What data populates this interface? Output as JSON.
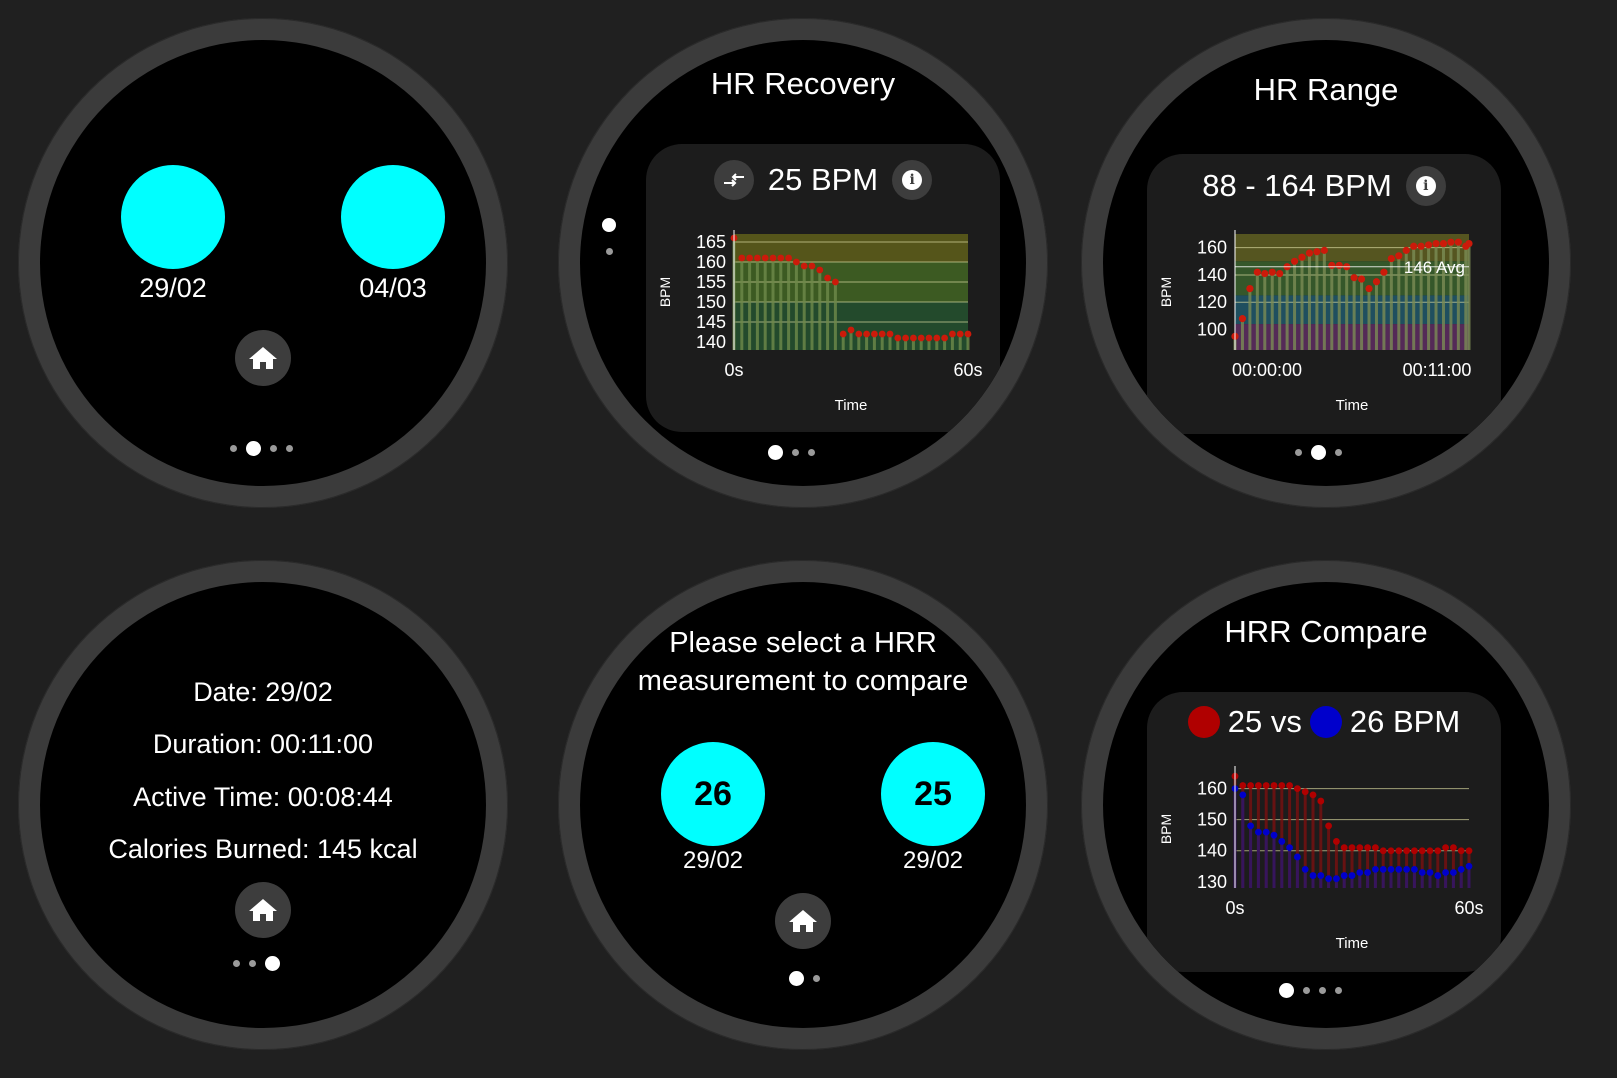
{
  "screen1": {
    "dates": [
      "29/02",
      "04/03"
    ],
    "home_label": "home"
  },
  "screen2": {
    "title": "HR Recovery",
    "value": "25 BPM",
    "ylabel": "BPM",
    "xlabel": "Time",
    "xticks": [
      "0s",
      "60s"
    ],
    "yticks": [
      "165",
      "160",
      "155",
      "150",
      "145",
      "140"
    ]
  },
  "screen3": {
    "title": "HR Range",
    "value": "88 - 164 BPM",
    "ylabel": "BPM",
    "xlabel": "Time",
    "xticks": [
      "00:00:00",
      "00:11:00"
    ],
    "yticks": [
      "160",
      "140",
      "120",
      "100"
    ],
    "avg_label": "146 Avg"
  },
  "screen4": {
    "date": "Date: 29/02",
    "duration": "Duration: 00:11:00",
    "active_time": "Active Time: 00:08:44",
    "calories": "Calories Burned: 145 kcal"
  },
  "screen5": {
    "prompt_line1": "Please select a HRR",
    "prompt_line2": "measurement to compare",
    "items": [
      {
        "value": "26",
        "date": "29/02"
      },
      {
        "value": "25",
        "date": "29/02"
      }
    ]
  },
  "screen6": {
    "title": "HRR Compare",
    "value_a": "25 vs",
    "value_b": "26 BPM",
    "ylabel": "BPM",
    "xlabel": "Time",
    "xticks": [
      "0s",
      "60s"
    ],
    "yticks": [
      "160",
      "150",
      "140",
      "130"
    ]
  },
  "colors": {
    "accent": "#00ffff",
    "recovery_point": "#cc1a0a",
    "compare_a": "#b00000",
    "compare_b": "#0000cc"
  },
  "chart_data": [
    {
      "type": "bar",
      "title": "",
      "xlabel": "Time",
      "ylabel": "BPM",
      "ylim": [
        138,
        167
      ],
      "xlim": [
        0,
        60
      ],
      "x": [
        0,
        2,
        4,
        6,
        8,
        10,
        12,
        14,
        16,
        18,
        20,
        22,
        24,
        26,
        28,
        30,
        32,
        34,
        36,
        38,
        40,
        42,
        44,
        46,
        48,
        50,
        52,
        54,
        56,
        58,
        60
      ],
      "series": [
        {
          "values": [
            166,
            161,
            161,
            161,
            161,
            161,
            161,
            161,
            160,
            159,
            159,
            158,
            156,
            155,
            142,
            143,
            142,
            142,
            142,
            142,
            142,
            141,
            141,
            141,
            141,
            141,
            141,
            141,
            142,
            142,
            142
          ]
        }
      ]
    },
    {
      "type": "bar",
      "title": "",
      "xlabel": "Time",
      "ylabel": "BPM",
      "ylim": [
        85,
        170
      ],
      "x": [
        0,
        0.35,
        0.7,
        1.05,
        1.4,
        1.75,
        2.1,
        2.45,
        2.8,
        3.15,
        3.5,
        3.85,
        4.2,
        4.55,
        4.9,
        5.25,
        5.6,
        5.95,
        6.3,
        6.65,
        7,
        7.35,
        7.7,
        8.05,
        8.4,
        8.75,
        9.1,
        9.45,
        9.8,
        10.15,
        10.5,
        10.85,
        11
      ],
      "series": [
        {
          "values": [
            95,
            108,
            130,
            142,
            141,
            142,
            141,
            146,
            150,
            153,
            156,
            157,
            158,
            147,
            147,
            146,
            138,
            137,
            130,
            135,
            142,
            152,
            154,
            158,
            161,
            161,
            162,
            163,
            163,
            164,
            164,
            161,
            163
          ]
        }
      ],
      "annotations": [
        "146 Avg"
      ]
    },
    {
      "type": "bar",
      "title": "",
      "xlabel": "Time",
      "ylabel": "BPM",
      "ylim": [
        128,
        166
      ],
      "x": [
        0,
        2,
        4,
        6,
        8,
        10,
        12,
        14,
        16,
        18,
        20,
        22,
        24,
        26,
        28,
        30,
        32,
        34,
        36,
        38,
        40,
        42,
        44,
        46,
        48,
        50,
        52,
        54,
        56,
        58,
        60
      ],
      "series": [
        {
          "values": [
            164,
            161,
            161,
            161,
            161,
            161,
            161,
            161,
            160,
            159,
            158,
            156,
            148,
            143,
            141,
            141,
            141,
            141,
            141,
            140,
            140,
            140,
            140,
            140,
            140,
            140,
            140,
            141,
            141,
            140,
            140
          ]
        },
        {
          "values": [
            160,
            158,
            148,
            146,
            146,
            145,
            143,
            141,
            138,
            134,
            132,
            132,
            131,
            131,
            132,
            132,
            133,
            133,
            134,
            134,
            134,
            134,
            134,
            134,
            133,
            133,
            132,
            133,
            133,
            134,
            135
          ]
        }
      ]
    }
  ]
}
